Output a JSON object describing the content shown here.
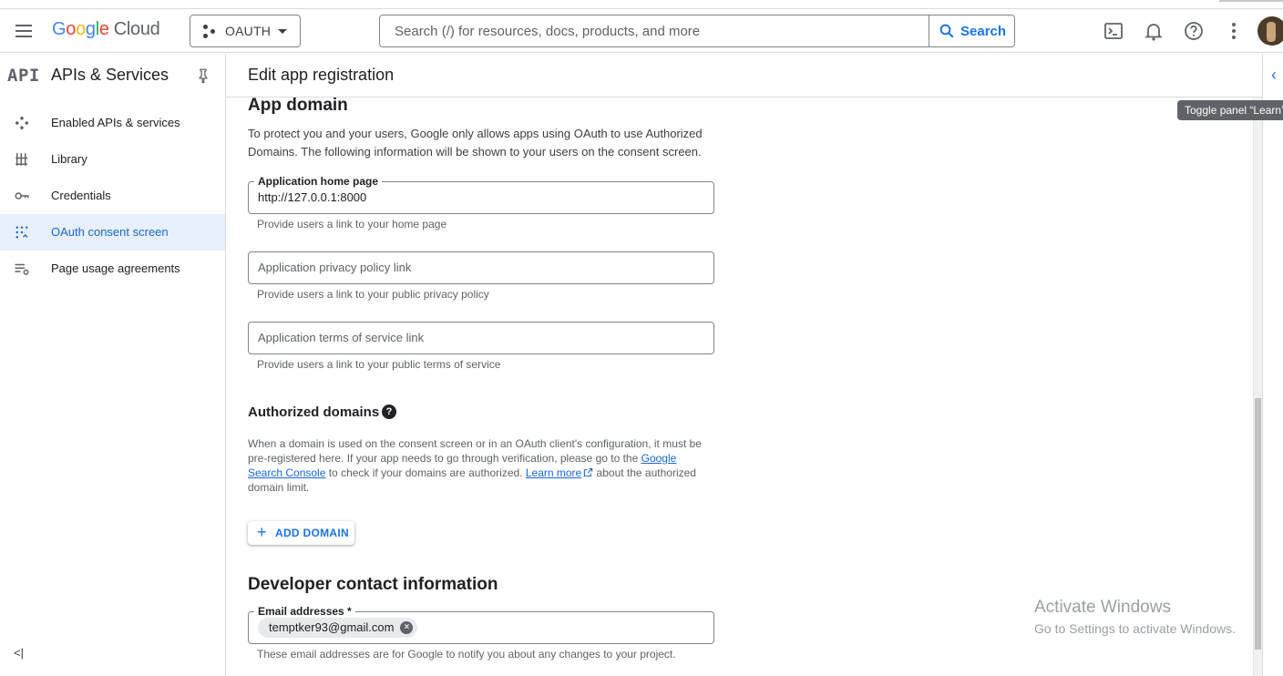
{
  "header": {
    "logo": {
      "g1": "G",
      "g2": "o",
      "g3": "o",
      "g4": "g",
      "g5": "l",
      "g6": "e",
      "cloud": "Cloud"
    },
    "project": "OAUTH",
    "search_placeholder": "Search (/) for resources, docs, products, and more",
    "search_button": "Search"
  },
  "sidebar": {
    "logo_text": "API",
    "title": "APIs & Services",
    "items": [
      {
        "label": "Enabled APIs & services",
        "icon": "apis-icon"
      },
      {
        "label": "Library",
        "icon": "library-icon"
      },
      {
        "label": "Credentials",
        "icon": "key-icon"
      },
      {
        "label": "OAuth consent screen",
        "icon": "consent-icon",
        "active": true
      },
      {
        "label": "Page usage agreements",
        "icon": "settings-list-icon"
      }
    ],
    "collapse": "<|"
  },
  "page": {
    "title": "Edit app registration",
    "app_domain": {
      "heading": "App domain",
      "intro": "To protect you and your users, Google only allows apps using OAuth to use Authorized Domains. The following information will be shown to your users on the consent screen.",
      "home_page_label": "Application home page",
      "home_page_value": "http://127.0.0.1:8000",
      "home_page_hint": "Provide users a link to your home page",
      "privacy_placeholder": "Application privacy policy link",
      "privacy_hint": "Provide users a link to your public privacy policy",
      "tos_placeholder": "Application terms of service link",
      "tos_hint": "Provide users a link to your public terms of service"
    },
    "authorized_domains": {
      "heading": "Authorized domains",
      "text_1": "When a domain is used on the consent screen or in an OAuth client's configuration, it must be pre-registered here. If your app needs to go through verification, please go to the ",
      "link_1": "Google Search Console",
      "text_2": " to check if your domains are authorized. ",
      "link_2": "Learn more",
      "text_3": " about the authorized domain limit.",
      "add_button": "ADD DOMAIN"
    },
    "developer_contact": {
      "heading": "Developer contact information",
      "email_label": "Email addresses *",
      "email_chip": "temptker93@gmail.com",
      "hint": "These email addresses are for Google to notify you about any changes to your project."
    }
  },
  "tooltip": "Toggle panel “Learn”",
  "watermark": {
    "line1": "Activate Windows",
    "line2": "Go to Settings to activate Windows."
  },
  "colors": {
    "accent": "#1a73e8",
    "active_bg": "#e8f0fe"
  }
}
